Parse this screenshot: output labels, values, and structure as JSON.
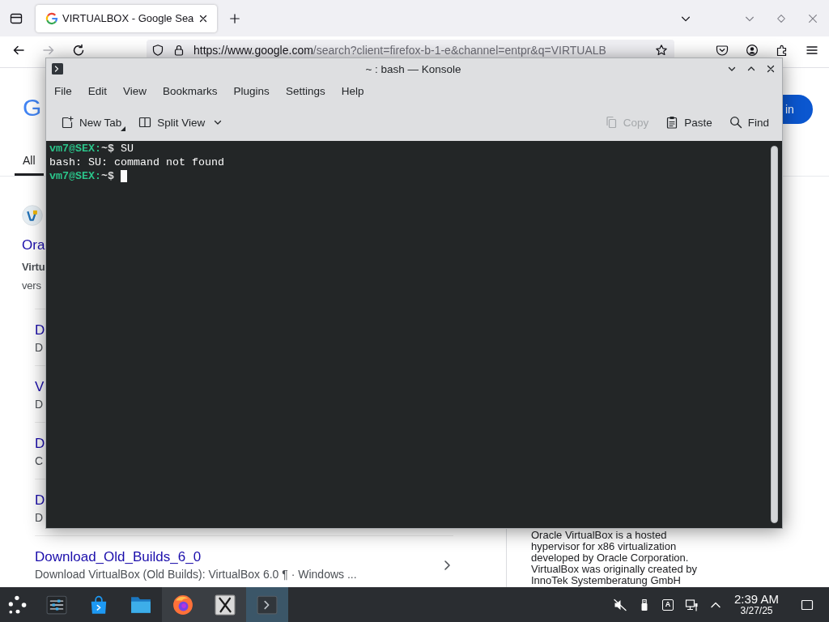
{
  "browser": {
    "tab": {
      "title": "VIRTUALBOX - Google Sea",
      "selected": true
    },
    "nav": [
      {
        "kind": "back",
        "disabled": false
      },
      {
        "kind": "forward",
        "disabled": true
      },
      {
        "kind": "reload",
        "disabled": false
      }
    ],
    "url": {
      "host": "https://www.google.com",
      "path": "/search?client=firefox-b-1-e&channel=entpr&q=VIRTUALB"
    }
  },
  "page": {
    "logo": "G",
    "sign_in": "in",
    "tabs": [
      {
        "label": "All",
        "selected": true
      }
    ],
    "result": {
      "title": "Ora",
      "snippet_lines": [
        "**Virtu**",
        "vers"
      ]
    },
    "sublinks": [
      {
        "title": "D",
        "snippet": "D"
      },
      {
        "title": "V",
        "snippet": "D"
      },
      {
        "title": "D",
        "snippet": "C"
      },
      {
        "title": "D",
        "snippet": "D"
      }
    ],
    "more_link": {
      "title": "Download_Old_Builds_6_0",
      "snippet": "Download VirtualBox (Old Builds): VirtualBox 6.0 ¶ · Windows ..."
    },
    "knowledge_panel": {
      "lines": [
        "Oracle VirtualBox is a hosted",
        "hypervisor for x86 virtualization",
        "developed by Oracle Corporation.",
        "VirtualBox was originally created by",
        "InnoTek Systemberatung GmbH"
      ]
    }
  },
  "konsole": {
    "title": "~ : bash — Konsole",
    "menu": [
      "File",
      "Edit",
      "View",
      "Bookmarks",
      "Plugins",
      "Settings",
      "Help"
    ],
    "toolbar_left": [
      {
        "kind": "new-tab",
        "label": "New Tab",
        "disabled": false,
        "dropdown": {
          "kind": "corner"
        }
      },
      {
        "kind": "split-view",
        "label": "Split View",
        "disabled": false,
        "dropdown": {
          "kind": "arrow"
        }
      }
    ],
    "toolbar_right": [
      {
        "kind": "copy",
        "label": "Copy",
        "disabled": true
      },
      {
        "kind": "paste",
        "label": "Paste",
        "disabled": false
      },
      {
        "kind": "find",
        "label": "Find",
        "disabled": false
      }
    ],
    "lines": [
      {
        "kind": "prompt",
        "prompt": "vm7@SEX:",
        "dir": "~$",
        "command": "SU",
        "cursor": false
      },
      {
        "kind": "output",
        "text": "bash: SU: command not found",
        "cursor": false
      },
      {
        "kind": "prompt",
        "prompt": "vm7@SEX:",
        "dir": "~$",
        "cursor": true
      }
    ]
  },
  "taskbar": {
    "apps": [
      {
        "kind": "launcher",
        "open": false,
        "selected": false
      },
      {
        "kind": "settings",
        "open": false,
        "selected": false
      },
      {
        "kind": "store",
        "open": false,
        "selected": false
      },
      {
        "kind": "files",
        "open": false,
        "selected": false
      },
      {
        "kind": "browser",
        "open": true,
        "selected": false
      },
      {
        "kind": "x-app",
        "open": true,
        "selected": false
      },
      {
        "kind": "terminal",
        "open": true,
        "selected": true
      }
    ],
    "tray": {
      "volume_muted": true,
      "keyboard_layout": "A"
    },
    "clock": {
      "time": "2:39 AM",
      "date": "3/27/25"
    }
  }
}
